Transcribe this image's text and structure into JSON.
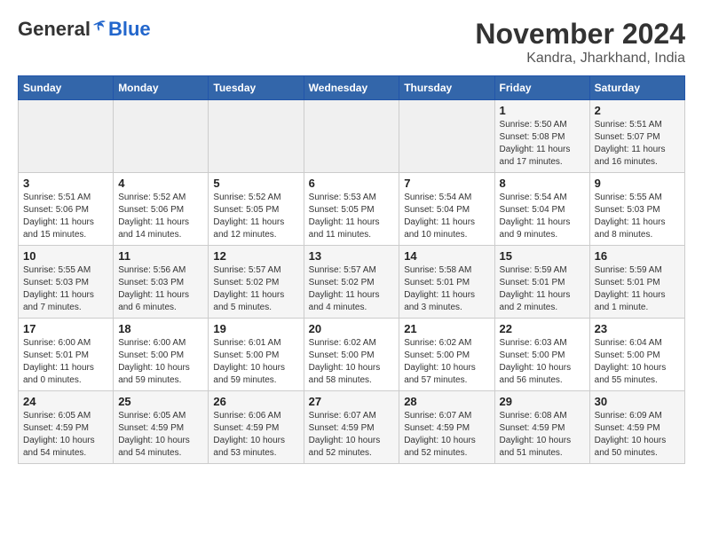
{
  "header": {
    "logo_general": "General",
    "logo_blue": "Blue",
    "month_title": "November 2024",
    "location": "Kandra, Jharkhand, India"
  },
  "weekdays": [
    "Sunday",
    "Monday",
    "Tuesday",
    "Wednesday",
    "Thursday",
    "Friday",
    "Saturday"
  ],
  "weeks": [
    [
      {
        "day": "",
        "detail": ""
      },
      {
        "day": "",
        "detail": ""
      },
      {
        "day": "",
        "detail": ""
      },
      {
        "day": "",
        "detail": ""
      },
      {
        "day": "",
        "detail": ""
      },
      {
        "day": "1",
        "detail": "Sunrise: 5:50 AM\nSunset: 5:08 PM\nDaylight: 11 hours and 17 minutes."
      },
      {
        "day": "2",
        "detail": "Sunrise: 5:51 AM\nSunset: 5:07 PM\nDaylight: 11 hours and 16 minutes."
      }
    ],
    [
      {
        "day": "3",
        "detail": "Sunrise: 5:51 AM\nSunset: 5:06 PM\nDaylight: 11 hours and 15 minutes."
      },
      {
        "day": "4",
        "detail": "Sunrise: 5:52 AM\nSunset: 5:06 PM\nDaylight: 11 hours and 14 minutes."
      },
      {
        "day": "5",
        "detail": "Sunrise: 5:52 AM\nSunset: 5:05 PM\nDaylight: 11 hours and 12 minutes."
      },
      {
        "day": "6",
        "detail": "Sunrise: 5:53 AM\nSunset: 5:05 PM\nDaylight: 11 hours and 11 minutes."
      },
      {
        "day": "7",
        "detail": "Sunrise: 5:54 AM\nSunset: 5:04 PM\nDaylight: 11 hours and 10 minutes."
      },
      {
        "day": "8",
        "detail": "Sunrise: 5:54 AM\nSunset: 5:04 PM\nDaylight: 11 hours and 9 minutes."
      },
      {
        "day": "9",
        "detail": "Sunrise: 5:55 AM\nSunset: 5:03 PM\nDaylight: 11 hours and 8 minutes."
      }
    ],
    [
      {
        "day": "10",
        "detail": "Sunrise: 5:55 AM\nSunset: 5:03 PM\nDaylight: 11 hours and 7 minutes."
      },
      {
        "day": "11",
        "detail": "Sunrise: 5:56 AM\nSunset: 5:03 PM\nDaylight: 11 hours and 6 minutes."
      },
      {
        "day": "12",
        "detail": "Sunrise: 5:57 AM\nSunset: 5:02 PM\nDaylight: 11 hours and 5 minutes."
      },
      {
        "day": "13",
        "detail": "Sunrise: 5:57 AM\nSunset: 5:02 PM\nDaylight: 11 hours and 4 minutes."
      },
      {
        "day": "14",
        "detail": "Sunrise: 5:58 AM\nSunset: 5:01 PM\nDaylight: 11 hours and 3 minutes."
      },
      {
        "day": "15",
        "detail": "Sunrise: 5:59 AM\nSunset: 5:01 PM\nDaylight: 11 hours and 2 minutes."
      },
      {
        "day": "16",
        "detail": "Sunrise: 5:59 AM\nSunset: 5:01 PM\nDaylight: 11 hours and 1 minute."
      }
    ],
    [
      {
        "day": "17",
        "detail": "Sunrise: 6:00 AM\nSunset: 5:01 PM\nDaylight: 11 hours and 0 minutes."
      },
      {
        "day": "18",
        "detail": "Sunrise: 6:00 AM\nSunset: 5:00 PM\nDaylight: 10 hours and 59 minutes."
      },
      {
        "day": "19",
        "detail": "Sunrise: 6:01 AM\nSunset: 5:00 PM\nDaylight: 10 hours and 59 minutes."
      },
      {
        "day": "20",
        "detail": "Sunrise: 6:02 AM\nSunset: 5:00 PM\nDaylight: 10 hours and 58 minutes."
      },
      {
        "day": "21",
        "detail": "Sunrise: 6:02 AM\nSunset: 5:00 PM\nDaylight: 10 hours and 57 minutes."
      },
      {
        "day": "22",
        "detail": "Sunrise: 6:03 AM\nSunset: 5:00 PM\nDaylight: 10 hours and 56 minutes."
      },
      {
        "day": "23",
        "detail": "Sunrise: 6:04 AM\nSunset: 5:00 PM\nDaylight: 10 hours and 55 minutes."
      }
    ],
    [
      {
        "day": "24",
        "detail": "Sunrise: 6:05 AM\nSunset: 4:59 PM\nDaylight: 10 hours and 54 minutes."
      },
      {
        "day": "25",
        "detail": "Sunrise: 6:05 AM\nSunset: 4:59 PM\nDaylight: 10 hours and 54 minutes."
      },
      {
        "day": "26",
        "detail": "Sunrise: 6:06 AM\nSunset: 4:59 PM\nDaylight: 10 hours and 53 minutes."
      },
      {
        "day": "27",
        "detail": "Sunrise: 6:07 AM\nSunset: 4:59 PM\nDaylight: 10 hours and 52 minutes."
      },
      {
        "day": "28",
        "detail": "Sunrise: 6:07 AM\nSunset: 4:59 PM\nDaylight: 10 hours and 52 minutes."
      },
      {
        "day": "29",
        "detail": "Sunrise: 6:08 AM\nSunset: 4:59 PM\nDaylight: 10 hours and 51 minutes."
      },
      {
        "day": "30",
        "detail": "Sunrise: 6:09 AM\nSunset: 4:59 PM\nDaylight: 10 hours and 50 minutes."
      }
    ]
  ]
}
